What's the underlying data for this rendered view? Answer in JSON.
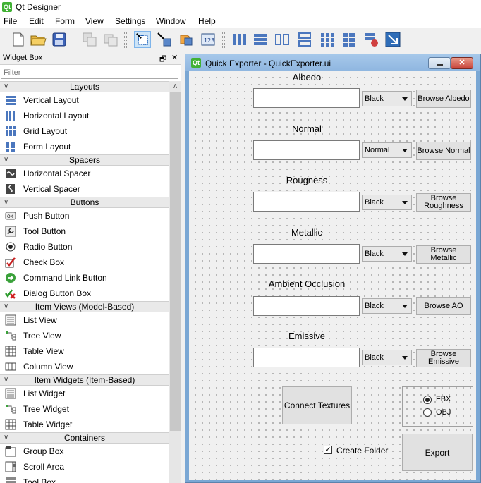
{
  "app": {
    "title": "Qt Designer"
  },
  "menu": [
    "File",
    "Edit",
    "Form",
    "View",
    "Settings",
    "Window",
    "Help"
  ],
  "widget_box": {
    "title": "Widget Box",
    "float_glyph": "🗗",
    "close_glyph": "✕",
    "filter_placeholder": "Filter",
    "categories": [
      {
        "name": "Layouts",
        "items": [
          "Vertical Layout",
          "Horizontal Layout",
          "Grid Layout",
          "Form Layout"
        ]
      },
      {
        "name": "Spacers",
        "items": [
          "Horizontal Spacer",
          "Vertical Spacer"
        ]
      },
      {
        "name": "Buttons",
        "items": [
          "Push Button",
          "Tool Button",
          "Radio Button",
          "Check Box",
          "Command Link Button",
          "Dialog Button Box"
        ]
      },
      {
        "name": "Item Views (Model-Based)",
        "items": [
          "List View",
          "Tree View",
          "Table View",
          "Column View"
        ]
      },
      {
        "name": "Item Widgets (Item-Based)",
        "items": [
          "List Widget",
          "Tree Widget",
          "Table Widget"
        ]
      },
      {
        "name": "Containers",
        "items": [
          "Group Box",
          "Scroll Area",
          "Tool Box"
        ]
      }
    ]
  },
  "form": {
    "title": "Quick Exporter - QuickExporter.ui",
    "rows": [
      {
        "label": "Albedo",
        "combo": "Black",
        "button": "Browse Albedo"
      },
      {
        "label": "Normal",
        "combo": "Normal",
        "button": "Browse Normal"
      },
      {
        "label": "Rougness",
        "combo": "Black",
        "button": "Browse Roughness"
      },
      {
        "label": "Metallic",
        "combo": "Black",
        "button": "Browse Metallic"
      },
      {
        "label": "Ambient Occlusion",
        "combo": "Black",
        "button": "Browse AO"
      },
      {
        "label": "Emissive",
        "combo": "Black",
        "button": "Browse Emissive"
      }
    ],
    "connect_button": "Connect Textures",
    "format_options": [
      {
        "label": "FBX",
        "checked": true
      },
      {
        "label": "OBJ",
        "checked": false
      }
    ],
    "create_folder": {
      "label": "Create Folder",
      "checked": true
    },
    "export_button": "Export"
  }
}
